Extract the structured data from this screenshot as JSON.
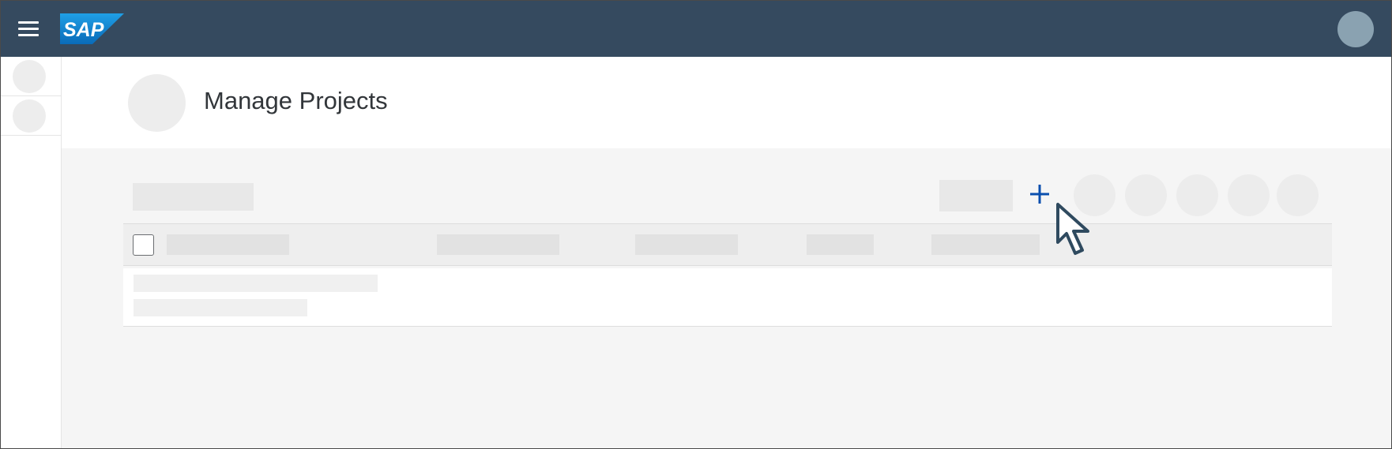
{
  "app": {
    "logo_text": "SAP",
    "page_title": "Manage Projects"
  },
  "colors": {
    "shellbar": "#354a5f",
    "avatar": "#8aa2b1",
    "logo_blue": "#1b8bd4",
    "accent": "#0a4fae",
    "skeleton": "#e8e8e8",
    "content_bg": "#f5f5f5"
  },
  "icons": {
    "menu": "hamburger-menu-icon",
    "add": "plus-icon",
    "pointer": "mouse-cursor-icon"
  }
}
